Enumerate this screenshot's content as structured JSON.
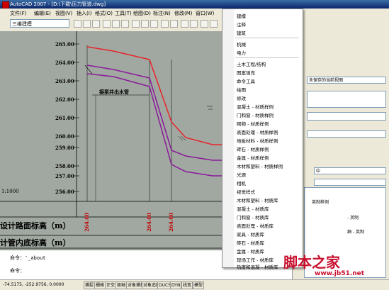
{
  "window": {
    "title": "AutoCAD 2007 - [D:\\下载\\压力管道.dwg]"
  },
  "menubar": [
    "文件(F)",
    "编辑(E)",
    "视图(V)",
    "插入(I)",
    "格式(O)",
    "工具(T)",
    "绘图(D)",
    "标注(N)",
    "修改(M)",
    "窗口(W)"
  ],
  "toolbar": {
    "workspace_combo": "三维建模"
  },
  "drawing": {
    "elevation_labels": [
      "265.00",
      "264.00",
      "263.00",
      "262.00",
      "261.00",
      "260.00",
      "259.00",
      "258.00",
      "257.00",
      "256.00"
    ],
    "annotation": "接泵井出水管",
    "scale_label": "1:1000",
    "row_label_1": "设计路面标高（m）",
    "row_label_2": "计管内底标高（m）",
    "station_values": [
      "264.00",
      "264.00",
      "264.00"
    ],
    "colors": {
      "road_line": "#e8242a",
      "pipe_line": "#8b1a9a",
      "background": "#a1a8a1"
    }
  },
  "command": {
    "line1": "命令：'_about",
    "line2": "命令："
  },
  "status": {
    "coords": "-74.5175, -252.9756, 0.0000",
    "toggles": [
      "捕捉",
      "栅格",
      "正交",
      "极轴",
      "对象捕捉",
      "对象追踪",
      "DUCS",
      "DYN",
      "线宽",
      "模型"
    ]
  },
  "context_menu": {
    "items": [
      "建模",
      "注释",
      "建筑",
      "机械",
      "电力",
      "土木工程/结构",
      "图案填充",
      "命令工具",
      "绘图",
      "修改",
      "混凝土 - 材质样例",
      "门和窗 - 材质样例",
      "砌物 - 材质样例",
      "表面处理 - 材质样例",
      "地板材料 - 材质样例",
      "砖石 - 材质样例",
      "金属 - 材质样例",
      "木材和塑料 - 材质样例",
      "光源",
      "相机",
      "视觉样式",
      "木材和塑料 - 材质库",
      "混凝土 - 材质库",
      "门和窗 - 材质库",
      "表面处理 - 材质库",
      "家具 - 材质库",
      "砖石 - 材质库",
      "金属 - 材质库",
      "现场工作 - 材质库",
      "热度和混凝 - 材质库"
    ]
  },
  "right_panel": {
    "view_combo": "未保存的当前视图",
    "dropdown_value": "中",
    "list_items": [
      "英制样例",
      "- 英制",
      "细 - 英制"
    ]
  },
  "watermark": {
    "text": "脚本之家",
    "url": "www.jb51.net"
  }
}
